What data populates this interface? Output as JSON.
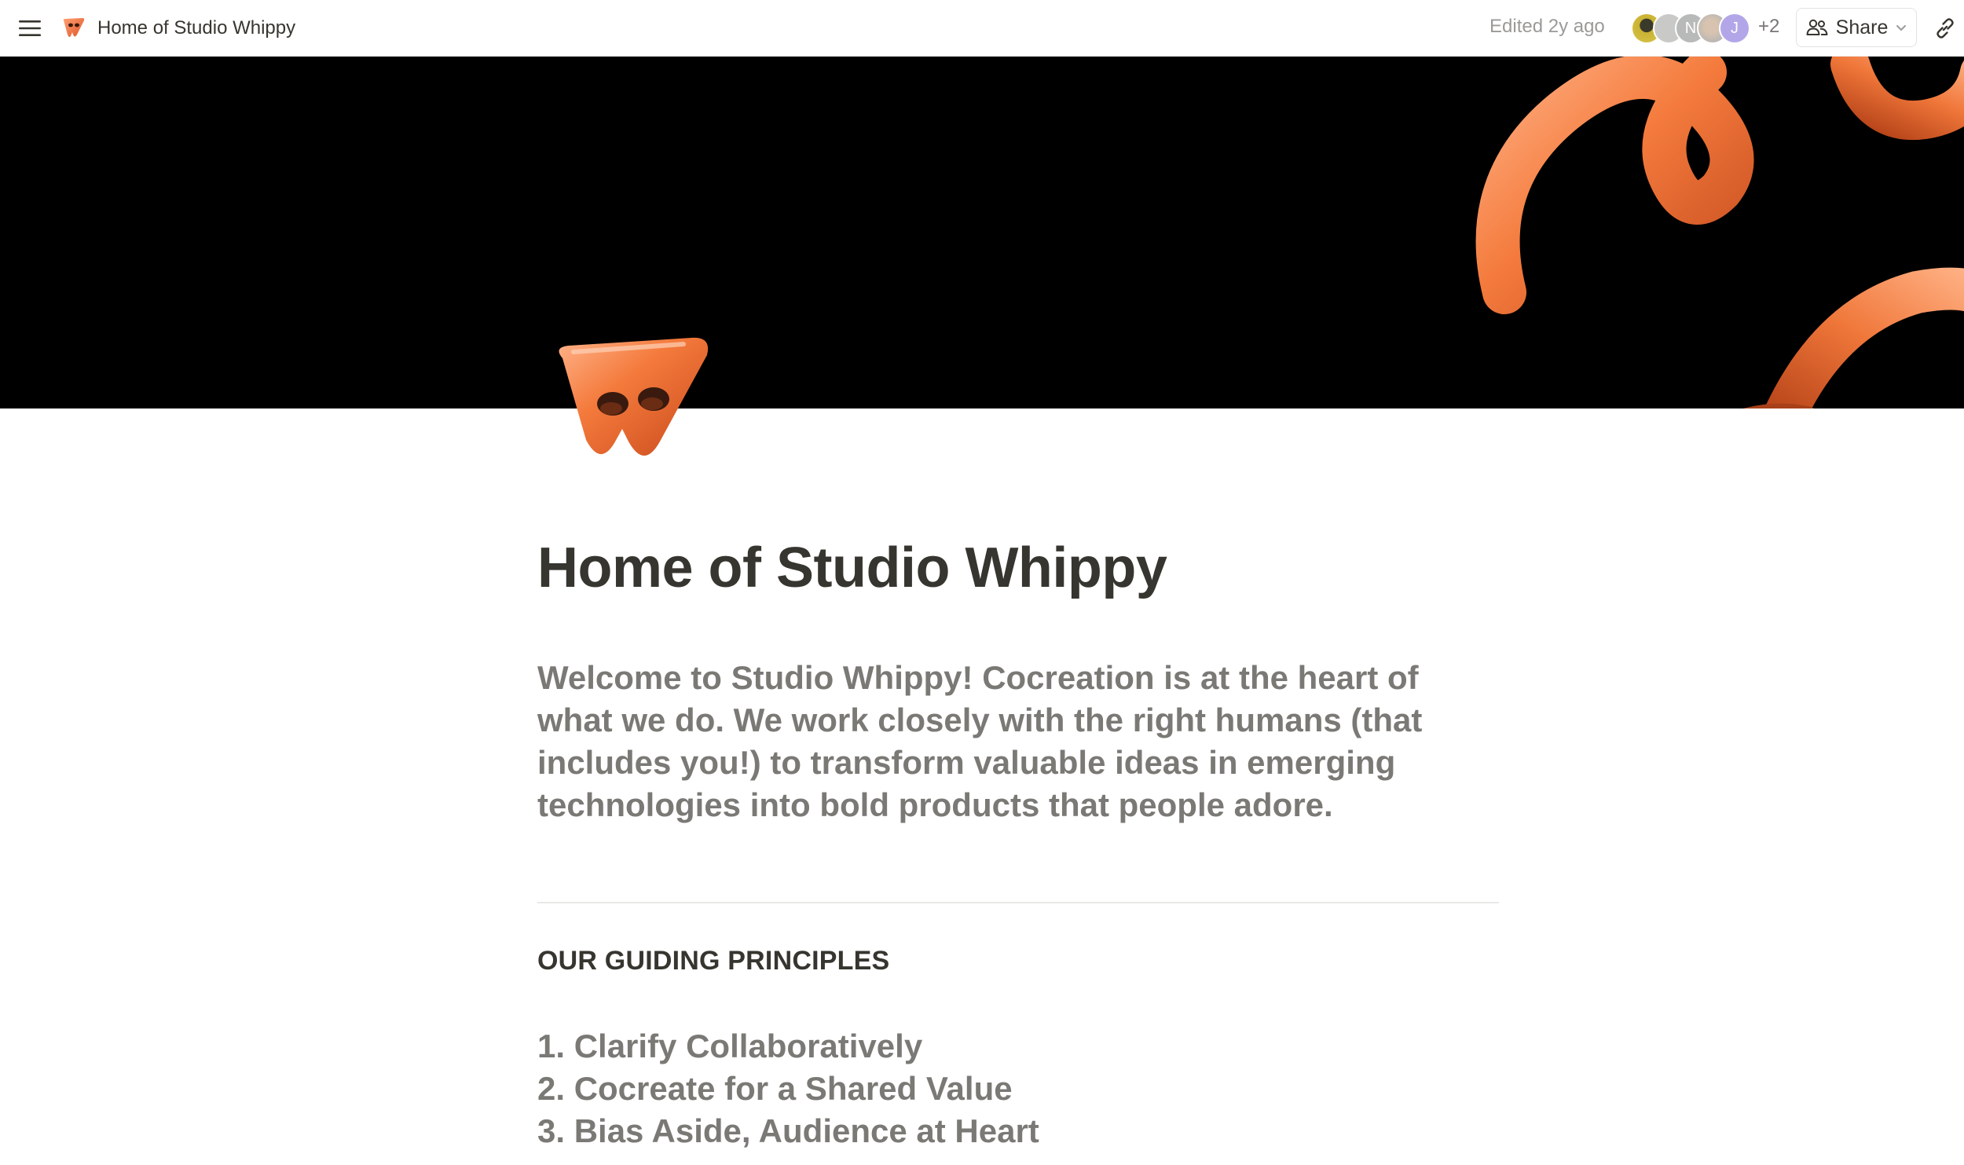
{
  "topbar": {
    "breadcrumb_title": "Home of Studio Whippy",
    "edited_status": "Edited 2y ago",
    "avatars": [
      {
        "name": "avatar-photo",
        "initial": ""
      },
      {
        "name": "avatar-grey",
        "initial": ""
      },
      {
        "name": "avatar-n",
        "initial": "N"
      },
      {
        "name": "avatar-photo-2",
        "initial": ""
      },
      {
        "name": "avatar-j",
        "initial": "J"
      }
    ],
    "more_collaborators": "+2",
    "share_label": "Share"
  },
  "icons": {
    "menu": "menu-icon",
    "page_emoji": "whippy-logo-icon",
    "share": "people-icon",
    "dropdown": "chevron-down-icon",
    "link": "link-icon"
  },
  "colors": {
    "accent_orange": "#f07a3a",
    "cover_background": "#000000",
    "muted_text": "#7a7975"
  },
  "page": {
    "title": "Home of Studio Whippy",
    "intro": "Welcome to Studio Whippy! Cocreation is at the heart of what we do. We work closely with the right humans (that includes you!) to transform valuable ideas in emerging technologies into bold products that people adore.",
    "section_heading": "OUR GUIDING PRINCIPLES",
    "principles": [
      "1. Clarify Collaboratively",
      "2. Cocreate for a Shared Value",
      "3. Bias Aside, Audience at Heart"
    ]
  }
}
